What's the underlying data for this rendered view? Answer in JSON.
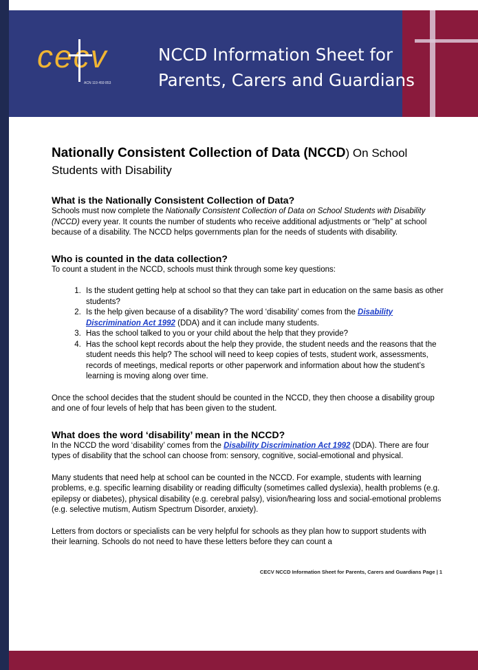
{
  "header": {
    "logo_text": "cecv",
    "acn": "ACN 119 459 853",
    "title_line1": "NCCD Information Sheet for",
    "title_line2": "Parents, Carers and Guardians"
  },
  "title": {
    "bold": "Nationally Consistent Collection of Data (NCCD",
    "close": ")",
    "rest": " On School Students with Disability"
  },
  "section1": {
    "heading": "What is the Nationally Consistent Collection of Data?",
    "p_a": "Schools must now complete the ",
    "p_em": "Nationally Consistent Collection of Data on School Students with Disability (NCCD)",
    "p_b": " every year. It counts the number of students who receive additional adjustments or “help” at school because of a disability. The NCCD helps governments plan for the needs of students with disability."
  },
  "section2": {
    "heading": "Who is counted in the data collection?",
    "intro": "To count a student in the NCCD, schools must think through some key questions:",
    "item1": "Is the student getting help at school so that they can take part in education on the same basis as other students?",
    "item2_a": "Is the help given because of a disability?  The word ‘disability’ comes from the ",
    "item2_link": "Disability Discrimination Act 1992",
    "item2_b": " (DDA) and it can include many students.",
    "item3": "Has the school talked to you or your child about the help that they provide?",
    "item4": "Has the school kept records about the help they provide, the student needs and the reasons that the student needs this help?  The school will need to keep copies of tests, student work, assessments, records of meetings, medical reports or other paperwork and information about how the student’s learning is moving along over time.",
    "after": "Once the school decides that the student should be counted in the NCCD, they then choose a disability group and one of four levels of help that has been given to the student."
  },
  "section3": {
    "heading": "What does the word ‘disability’ mean in the NCCD?",
    "p1_a": "In the NCCD the word ‘disability’ comes from the ",
    "p1_link": "Disability Discrimination Act 1992",
    "p1_b": " (DDA). There are four types of disability that the school can choose from: sensory, cognitive, social-emotional and physical.",
    "p2": "Many students that need help at school can be counted in the NCCD. For example, students with learning problems, e.g. specific learning disability or reading difficulty (sometimes called dyslexia), health problems (e.g. epilepsy or diabetes), physical disability (e.g. cerebral palsy), vision/hearing loss and social-emotional problems (e.g. selective mutism, Autism Spectrum Disorder, anxiety).",
    "p3": "Letters from doctors or specialists can be very helpful for schools as they plan how to support students with their learning.  Schools do not need to have these letters before they can count a"
  },
  "footer": {
    "text": "CECV NCCD Information Sheet for Parents, Carers and Guardians Page | 1"
  },
  "colors": {
    "navy": "#2f3a7e",
    "maroon": "#8a1a3c",
    "logo_gold": "#f0b533",
    "link_blue": "#1a3cc8"
  }
}
